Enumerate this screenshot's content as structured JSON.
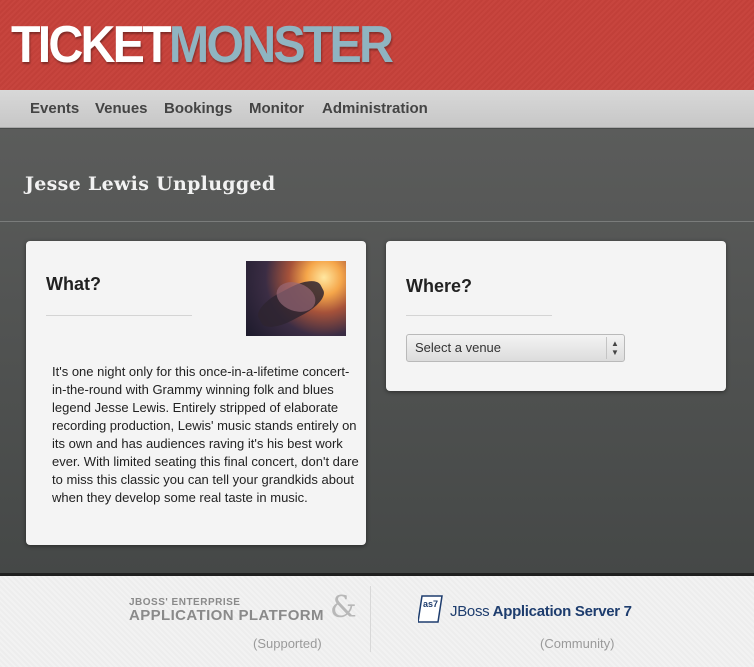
{
  "header": {
    "logo_part1": "TICKET",
    "logo_part2": "MONSTER",
    "bg_color": "#c6413a"
  },
  "nav": {
    "items": [
      {
        "label": "Events"
      },
      {
        "label": "Venues"
      },
      {
        "label": "Bookings"
      },
      {
        "label": "Monitor"
      },
      {
        "label": "Administration"
      }
    ]
  },
  "page": {
    "title": "Jesse Lewis Unplugged"
  },
  "what_card": {
    "heading": "What?",
    "image_icon": "event-photo-guitar",
    "description": "It's one night only for this once-in-a-lifetime concert-in-the-round with Grammy winning folk and blues legend Jesse Lewis. Entirely stripped of elaborate recording production, Lewis' music stands entirely on its own and has audiences raving it's his best work ever. With limited seating this final concert, don't dare to miss this classic you can tell your grandkids about when they develop some real taste in music."
  },
  "where_card": {
    "heading": "Where?",
    "venue_select": {
      "selected": "Select a venue",
      "arrows": "▲▼"
    }
  },
  "footer": {
    "eap_line1": "JBOSS' ENTERPRISE",
    "eap_line2": "APPLICATION PLATFORM",
    "ampersand": "&",
    "as7_logo_text": "as7",
    "as7_jboss": "JBoss",
    "as7_name": " Application Server 7",
    "supported": "(Supported)",
    "community": "(Community)"
  }
}
